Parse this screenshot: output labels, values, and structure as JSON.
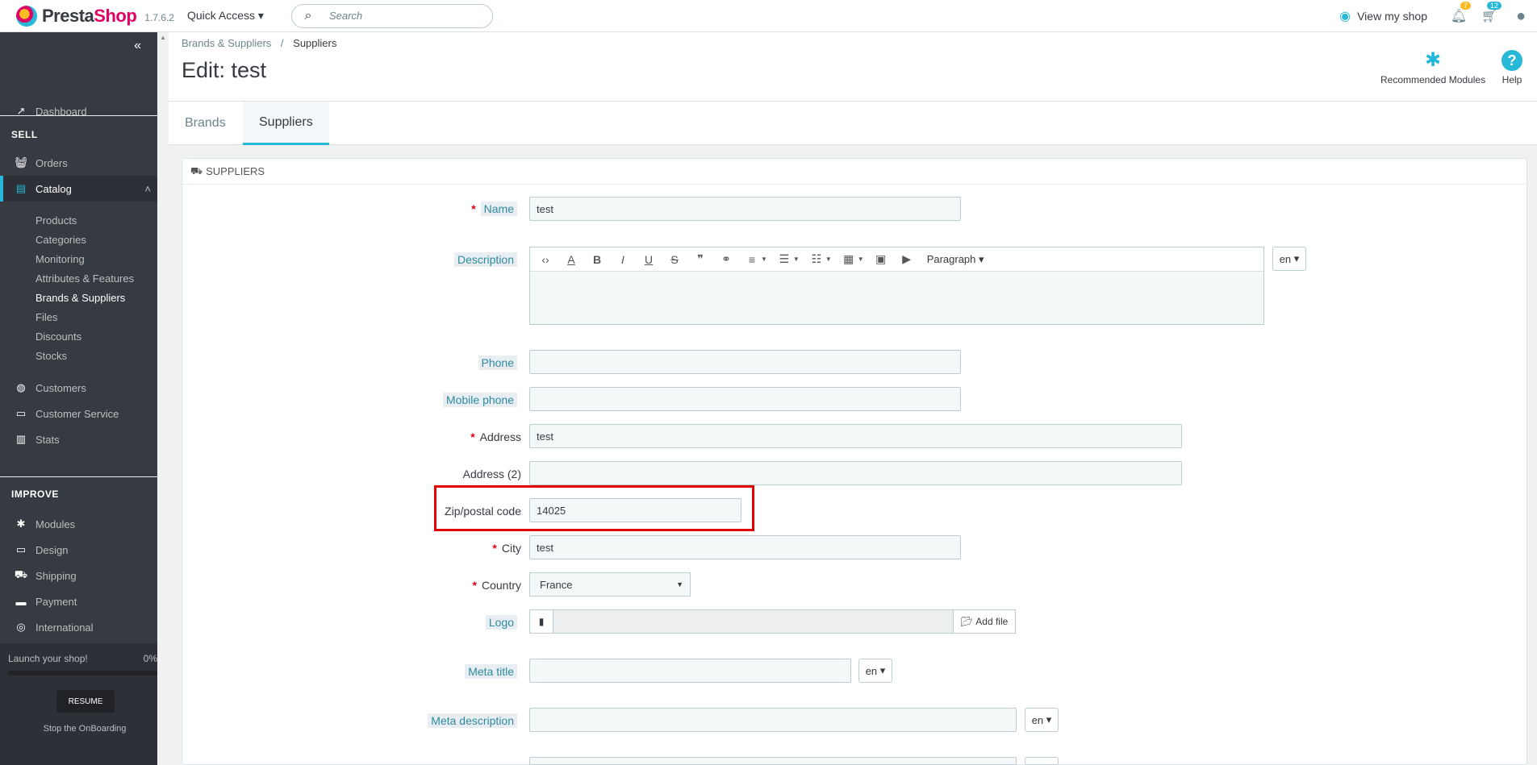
{
  "header": {
    "brand_pre": "Presta",
    "brand_post": "Shop",
    "version": "1.7.6.2",
    "quick_access": "Quick Access ▾",
    "search_placeholder": "Search",
    "view_shop": "View my shop",
    "notif_orders_count": "7",
    "notif_customers_count": "12"
  },
  "sidebar": {
    "dashboard": "Dashboard",
    "sell_title": "SELL",
    "orders": "Orders",
    "catalog": "Catalog",
    "catalog_sub": [
      "Products",
      "Categories",
      "Monitoring",
      "Attributes & Features",
      "Brands & Suppliers",
      "Files",
      "Discounts",
      "Stocks"
    ],
    "customers": "Customers",
    "customer_service": "Customer Service",
    "stats": "Stats",
    "improve_title": "IMPROVE",
    "modules": "Modules",
    "design": "Design",
    "shipping": "Shipping",
    "payment": "Payment",
    "international": "International",
    "onboarding_label": "Launch your shop!",
    "onboarding_pct": "0%",
    "resume": "RESUME",
    "stop": "Stop the OnBoarding"
  },
  "page": {
    "breadcrumb_parent": "Brands & Suppliers",
    "breadcrumb_sep": "/",
    "breadcrumb_current": "Suppliers",
    "title": "Edit: test",
    "recommended_modules": "Recommended Modules",
    "help": "Help",
    "tabs": [
      "Brands",
      "Suppliers"
    ]
  },
  "form": {
    "panel_title": "SUPPLIERS",
    "name_label": "Name",
    "name_value": "test",
    "description_label": "Description",
    "editor_paragraph": "Paragraph",
    "lang": "en",
    "phone_label": "Phone",
    "mobile_label": "Mobile phone",
    "address_label": "Address",
    "address_value": "test",
    "address2_label": "Address (2)",
    "zip_label": "Zip/postal code",
    "zip_value": "14025",
    "city_label": "City",
    "city_value": "test",
    "country_label": "Country",
    "country_value": "France",
    "logo_label": "Logo",
    "add_file": "Add file",
    "meta_title_label": "Meta title",
    "meta_desc_label": "Meta description"
  },
  "colors": {
    "accent": "#25b9d7",
    "brand": "#df0067",
    "sidebar_bg": "#363a41",
    "highlight": "#e20000"
  }
}
